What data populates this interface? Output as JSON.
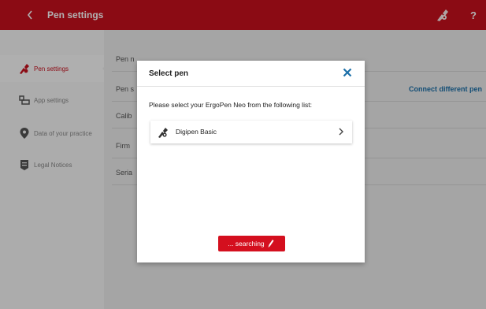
{
  "header": {
    "title": "Pen settings",
    "help_label": "?",
    "color": "#c8101e"
  },
  "sidebar": {
    "items": [
      {
        "label": "Pen settings",
        "icon": "pen-icon",
        "active": true
      },
      {
        "label": "App settings",
        "icon": "app-settings-icon",
        "active": false
      },
      {
        "label": "Data of your practice",
        "icon": "location-pin-icon",
        "active": false
      },
      {
        "label": "Legal Notices",
        "icon": "document-icon",
        "active": false
      }
    ]
  },
  "main": {
    "rows": [
      {
        "label": "Pen n"
      },
      {
        "label": "Pen s",
        "link": "Connect different pen"
      },
      {
        "label": "Calib"
      },
      {
        "label": "Firm"
      },
      {
        "label": "Seria"
      }
    ]
  },
  "modal": {
    "title": "Select pen",
    "prompt": "Please select your ErgoPen Neo from the following list:",
    "pens": [
      {
        "name": "Digipen Basic",
        "icon": "pen-icon"
      }
    ],
    "search_button": "... searching",
    "accent": "#1b6fa8"
  }
}
